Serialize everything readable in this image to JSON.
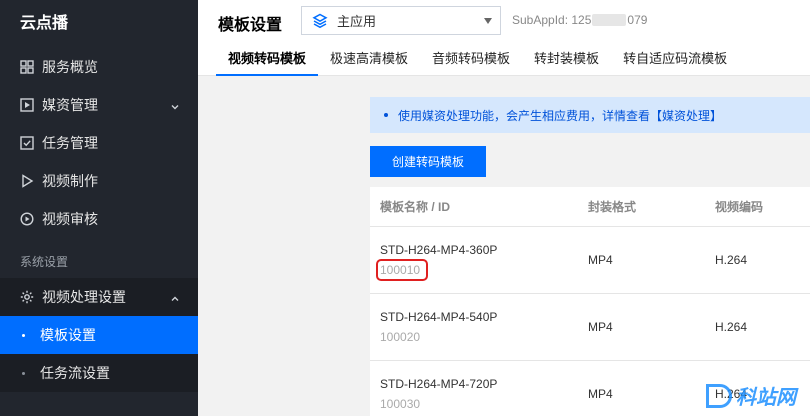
{
  "sidebar": {
    "brand": "云点播",
    "items": [
      {
        "label": "服务概览",
        "icon": "grid-icon"
      },
      {
        "label": "媒资管理",
        "icon": "play-square-icon"
      },
      {
        "label": "任务管理",
        "icon": "check-square-icon"
      },
      {
        "label": "视频制作",
        "icon": "play-triangle-icon"
      },
      {
        "label": "视频审核",
        "icon": "play-circle-icon"
      }
    ],
    "section_label": "系统设置",
    "group": {
      "label": "视频处理设置",
      "icon": "gear-icon",
      "children": [
        {
          "label": "模板设置",
          "active": true
        },
        {
          "label": "任务流设置",
          "active": false
        }
      ]
    }
  },
  "header": {
    "title": "模板设置",
    "app_select": {
      "value": "主应用"
    },
    "subappid_label": "SubAppId: 125",
    "subappid_tail": "079",
    "tabs": [
      {
        "label": "视频转码模板",
        "active": true
      },
      {
        "label": "极速高清模板",
        "active": false
      },
      {
        "label": "音频转码模板",
        "active": false
      },
      {
        "label": "转封装模板",
        "active": false
      },
      {
        "label": "转自适应码流模板",
        "active": false
      }
    ]
  },
  "content": {
    "notice": "使用媒资处理功能，会产生相应费用，详情查看【媒资处理】",
    "create_button": "创建转码模板",
    "table": {
      "headers": [
        "模板名称 / ID",
        "封装格式",
        "视频编码"
      ],
      "rows": [
        {
          "name": "STD-H264-MP4-360P",
          "id": "100010",
          "format": "MP4",
          "codec": "H.264",
          "highlight": true
        },
        {
          "name": "STD-H264-MP4-540P",
          "id": "100020",
          "format": "MP4",
          "codec": "H.264",
          "highlight": false
        },
        {
          "name": "STD-H264-MP4-720P",
          "id": "100030",
          "format": "MP4",
          "codec": "H.264",
          "highlight": false
        }
      ]
    }
  },
  "watermark": "科站网",
  "colors": {
    "accent": "#006eff",
    "sidebar_bg": "#22262e",
    "notice_bg": "#d5e7fd",
    "highlight_box": "#e02020"
  }
}
